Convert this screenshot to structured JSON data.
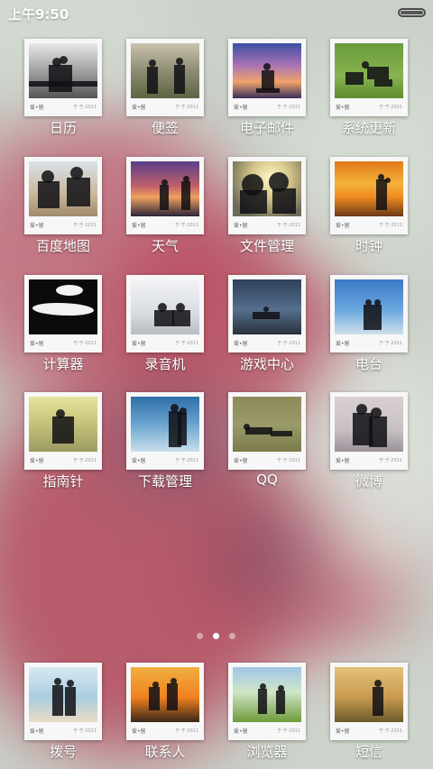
{
  "status_bar": {
    "time": "上午9:50"
  },
  "polaroid_caption": {
    "left": "爱•留",
    "right": "于·于·2011"
  },
  "pages": {
    "count": 3,
    "active_index": 1
  },
  "apps": [
    {
      "label": "日历",
      "icon": "calendar-icon"
    },
    {
      "label": "便签",
      "icon": "notes-icon"
    },
    {
      "label": "电子邮件",
      "icon": "email-icon"
    },
    {
      "label": "系统更新",
      "icon": "system-update-icon"
    },
    {
      "label": "百度地图",
      "icon": "baidu-maps-icon"
    },
    {
      "label": "天气",
      "icon": "weather-icon"
    },
    {
      "label": "文件管理",
      "icon": "file-manager-icon"
    },
    {
      "label": "时钟",
      "icon": "clock-icon"
    },
    {
      "label": "计算器",
      "icon": "calculator-icon"
    },
    {
      "label": "录音机",
      "icon": "recorder-icon"
    },
    {
      "label": "游戏中心",
      "icon": "game-center-icon"
    },
    {
      "label": "电台",
      "icon": "radio-icon"
    },
    {
      "label": "指南针",
      "icon": "compass-icon"
    },
    {
      "label": "下载管理",
      "icon": "download-manager-icon"
    },
    {
      "label": "QQ",
      "icon": "qq-icon"
    },
    {
      "label": "微博",
      "icon": "weibo-icon"
    }
  ],
  "dock": [
    {
      "label": "拨号",
      "icon": "dialer-icon"
    },
    {
      "label": "联系人",
      "icon": "contacts-icon"
    },
    {
      "label": "浏览器",
      "icon": "browser-icon"
    },
    {
      "label": "短信",
      "icon": "messages-icon"
    }
  ],
  "colors": {
    "wallpaper_base": "#c9d1c9",
    "wallpaper_red": "#b5485c",
    "label_text": "#ffffff"
  }
}
